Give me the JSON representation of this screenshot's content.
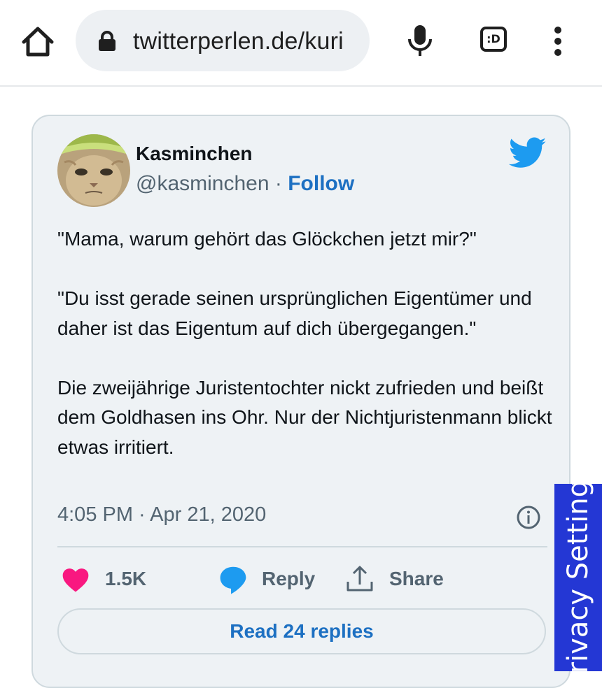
{
  "browser": {
    "url": "twitterperlen.de/kuri",
    "tab_switcher_label": ":D"
  },
  "tweet": {
    "author_name": "Kasminchen",
    "author_handle": "@kasminchen",
    "separator": "·",
    "follow_label": "Follow",
    "paragraphs": [
      "\"Mama, warum gehört das Glöckchen jetzt mir?\"",
      "\"Du isst gerade seinen ursprünglichen Eigentümer und daher ist das Eigentum auf dich übergegangen.\"",
      "Die zweijährige Juristentochter nickt zufrieden und beißt dem Goldhasen ins Ohr. Nur der Nichtjuristenmann blickt etwas irritiert."
    ],
    "timestamp": "4:05 PM · Apr 21, 2020",
    "likes": "1.5K",
    "reply_label": "Reply",
    "share_label": "Share",
    "read_replies_label": "Read 24 replies"
  },
  "privacy_tab": {
    "label": "Privacy Settings"
  },
  "colors": {
    "accent_blue": "#1d70c2",
    "twitter_blue": "#1d9bf0",
    "like_pink": "#f91880",
    "privacy_blue": "#2437d4",
    "card_bg": "#eef2f5"
  },
  "icons": [
    "home-icon",
    "lock-icon",
    "microphone-icon",
    "tab-switcher-icon",
    "more-vert-icon",
    "twitter-bird-icon",
    "info-icon",
    "heart-icon",
    "reply-bubble-icon",
    "share-icon"
  ]
}
